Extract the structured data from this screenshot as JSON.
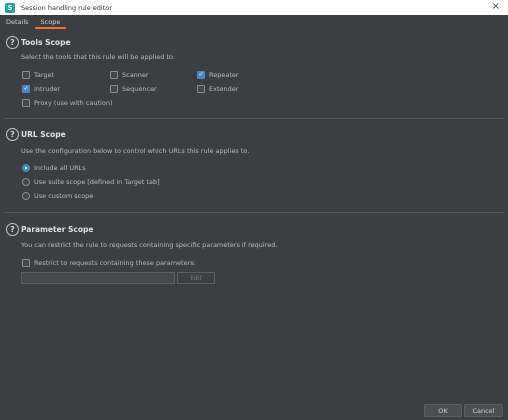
{
  "window": {
    "title": "Session handling rule editor",
    "app_icon_letter": "S"
  },
  "tabs": [
    {
      "label": "Details"
    },
    {
      "label": "Scope"
    }
  ],
  "tools_scope": {
    "heading": "Tools Scope",
    "description": "Select the tools that this rule will be applied to.",
    "tools": [
      {
        "label": "Target",
        "checked": false
      },
      {
        "label": "Scanner",
        "checked": false
      },
      {
        "label": "Repeater",
        "checked": true
      },
      {
        "label": "Intruder",
        "checked": true
      },
      {
        "label": "Sequencer",
        "checked": false
      },
      {
        "label": "Extender",
        "checked": false
      },
      {
        "label": "Proxy (use with caution)",
        "checked": false
      }
    ]
  },
  "url_scope": {
    "heading": "URL Scope",
    "description": "Use the configuration below to control which URLs this rule applies to.",
    "options": [
      {
        "label": "Include all URLs",
        "selected": true
      },
      {
        "label": "Use suite scope [defined in Target tab]",
        "selected": false
      },
      {
        "label": "Use custom scope",
        "selected": false
      }
    ]
  },
  "parameter_scope": {
    "heading": "Parameter Scope",
    "description": "You can restrict the rule to requests containing specific parameters if required.",
    "restrict_label": "Restrict to requests containing these parameters:",
    "restrict_checked": false,
    "parameter_value": "",
    "edit_label": "Edit"
  },
  "footer": {
    "ok_label": "OK",
    "cancel_label": "Cancel"
  },
  "help_glyph": "?",
  "close_glyph": "×",
  "check_glyph": "✓",
  "colors": {
    "accent": "#4a88c7",
    "tab_underline": "#e8743b",
    "background": "#3c3f41"
  }
}
